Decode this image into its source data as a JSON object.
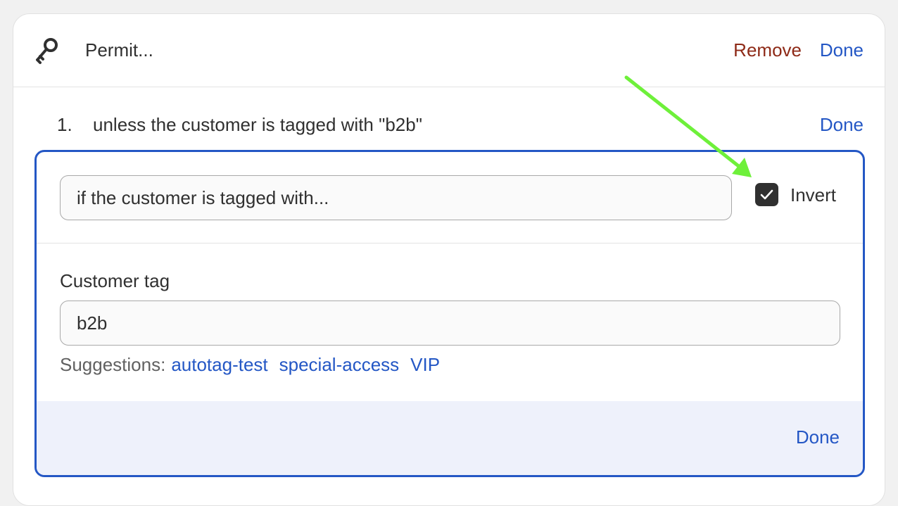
{
  "header": {
    "icon": "key-icon",
    "title": "Permit...",
    "remove_label": "Remove",
    "done_label": "Done"
  },
  "rule": {
    "number": "1.",
    "summary": "unless the customer is tagged with \"b2b\"",
    "done_label": "Done"
  },
  "editor": {
    "condition_value": "if the customer is tagged with...",
    "invert_label": "Invert",
    "invert_checked": true,
    "tag_label": "Customer tag",
    "tag_value": "b2b",
    "suggestions_label": "Suggestions:",
    "suggestions": [
      "autotag-test",
      "special-access",
      "VIP"
    ],
    "done_label": "Done"
  },
  "annotation": {
    "arrow_color": "#6ef03a"
  },
  "colors": {
    "link_blue": "#2457c5",
    "remove_red": "#8e2a17",
    "editor_border": "#2457c5",
    "footer_bg": "#eef1fb"
  }
}
